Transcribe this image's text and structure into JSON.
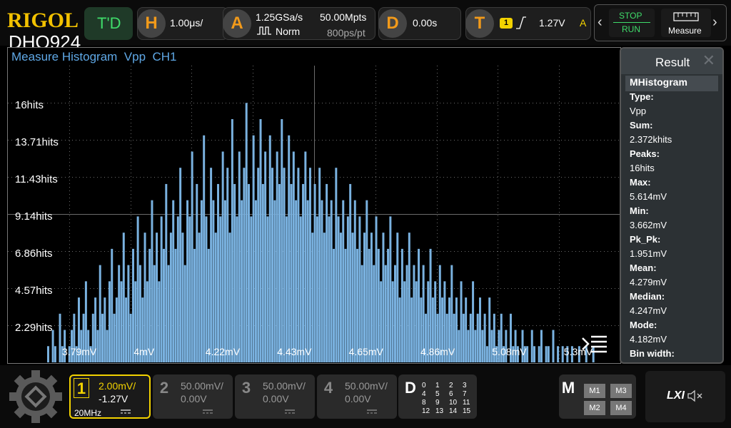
{
  "brand": {
    "logo": "RIGOL",
    "model": "DHO924"
  },
  "topbar": {
    "mode_label": "T'D",
    "horizontal": {
      "key": "H",
      "timebase": "1.00μs/"
    },
    "acquire": {
      "key": "A",
      "sample_rate": "1.25GSa/s",
      "mode": "Norm",
      "memory_depth": "50.00Mpts",
      "points": "800ps/pt"
    },
    "delay": {
      "key": "D",
      "value": "0.00s"
    },
    "trigger": {
      "key": "T",
      "source": "1",
      "level": "1.27V",
      "status": "A"
    },
    "run_control": {
      "stop_label": "STOP",
      "run_label": "RUN"
    },
    "measure_label": "Measure"
  },
  "plot": {
    "title": "Measure Histogram",
    "item": "Vpp",
    "channel": "CH1",
    "colors": {
      "grid": "#6b6b6b",
      "histogram": "#7ab2e0",
      "label": "#ffffff"
    }
  },
  "chart_data": {
    "type": "bar",
    "title": "Measure Histogram Vpp CH1",
    "xlabel": "",
    "ylabel": "",
    "y_tick_labels": [
      "16hits",
      "13.71hits",
      "11.43hits",
      "9.14hits",
      "6.86hits",
      "4.57hits",
      "2.29hits"
    ],
    "x_tick_labels": [
      "3.79mV",
      "4mV",
      "4.22mV",
      "4.43mV",
      "4.65mV",
      "4.86mV",
      "5.08mV",
      "5.3mV"
    ],
    "xlim": [
      3.662,
      5.614
    ],
    "ylim": [
      0,
      18.3
    ],
    "grid": true,
    "series": [
      {
        "values": [
          1,
          0,
          2,
          1,
          0,
          3,
          1,
          2,
          0,
          1,
          2,
          3,
          1,
          4,
          2,
          3,
          5,
          2,
          1,
          3,
          4,
          2,
          6,
          3,
          4,
          2,
          5,
          7,
          3,
          4,
          6,
          5,
          8,
          4,
          6,
          3,
          7,
          5,
          9,
          6,
          4,
          8,
          5,
          7,
          10,
          6,
          8,
          5,
          9,
          7,
          11,
          6,
          8,
          10,
          7,
          9,
          12,
          8,
          6,
          10,
          9,
          13,
          7,
          11,
          8,
          10,
          14,
          9,
          7,
          12,
          10,
          8,
          11,
          9,
          13,
          10,
          12,
          8,
          15,
          11,
          9,
          13,
          10,
          12,
          16,
          11,
          9,
          14,
          10,
          12,
          15,
          11,
          13,
          9,
          14,
          12,
          10,
          13,
          11,
          15,
          12,
          9,
          14,
          11,
          13,
          10,
          12,
          9,
          11,
          13,
          10,
          12,
          8,
          11,
          9,
          12,
          10,
          8,
          11,
          9,
          10,
          7,
          12,
          9,
          8,
          10,
          7,
          9,
          11,
          8,
          10,
          7,
          9,
          6,
          8,
          10,
          7,
          8,
          6,
          9,
          7,
          5,
          8,
          6,
          7,
          9,
          5,
          6,
          8,
          4,
          7,
          5,
          6,
          8,
          4,
          6,
          5,
          7,
          4,
          6,
          3,
          5,
          7,
          4,
          5,
          3,
          6,
          4,
          5,
          3,
          4,
          6,
          3,
          4,
          2,
          5,
          3,
          4,
          2,
          3,
          5,
          2,
          3,
          4,
          2,
          3,
          1,
          4,
          2,
          3,
          1,
          2,
          3,
          1,
          2,
          0,
          3,
          1,
          2,
          1,
          0,
          2,
          1,
          1,
          0,
          2,
          1,
          0,
          1,
          2,
          0,
          1,
          1,
          0,
          2,
          0,
          1,
          0,
          1,
          0,
          1,
          0,
          1,
          0,
          0,
          1,
          0,
          0,
          1,
          0,
          0,
          1
        ]
      }
    ]
  },
  "result": {
    "title": "Result",
    "subheader": "MHistogram",
    "rows": [
      {
        "label": "Type:",
        "value": "Vpp"
      },
      {
        "label": "Sum:",
        "value": "2.372khits"
      },
      {
        "label": "Peaks:",
        "value": "16hits"
      },
      {
        "label": "Max:",
        "value": "5.614mV"
      },
      {
        "label": "Min:",
        "value": "3.662mV"
      },
      {
        "label": "Pk_Pk:",
        "value": "1.951mV"
      },
      {
        "label": "Mean:",
        "value": "4.279mV"
      },
      {
        "label": "Median:",
        "value": "4.247mV"
      },
      {
        "label": "Mode:",
        "value": "4.182mV"
      },
      {
        "label": "Bin width:",
        "value": ""
      }
    ]
  },
  "channels": [
    {
      "num": "1",
      "scale": "2.00mV/",
      "offset": "-1.27V",
      "bw": "20MHz",
      "active": true,
      "color": "#f2d200"
    },
    {
      "num": "2",
      "scale": "50.00mV/",
      "offset": "0.00V",
      "active": false
    },
    {
      "num": "3",
      "scale": "50.00mV/",
      "offset": "0.00V",
      "active": false
    },
    {
      "num": "4",
      "scale": "50.00mV/",
      "offset": "0.00V",
      "active": false
    }
  ],
  "digital": {
    "key": "D",
    "rows": [
      [
        "0",
        "1",
        "2",
        "3"
      ],
      [
        "4",
        "5",
        "6",
        "7"
      ],
      [
        "8",
        "9",
        "10",
        "11"
      ],
      [
        "12",
        "13",
        "14",
        "15"
      ]
    ]
  },
  "math": {
    "key": "M",
    "items": [
      "M1",
      "M3",
      "M2",
      "M4"
    ]
  },
  "lxi": "LXI"
}
